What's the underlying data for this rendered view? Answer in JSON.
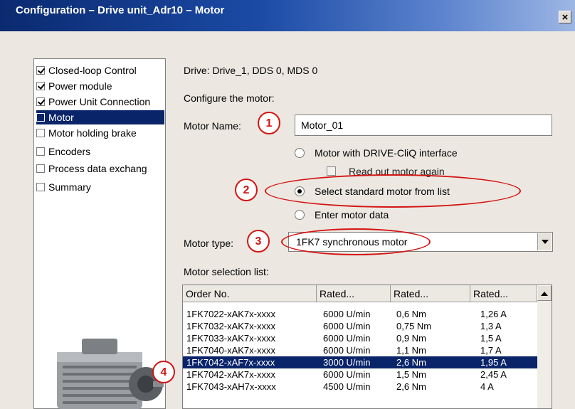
{
  "window": {
    "title": "Configuration – Drive unit_Adr10 – Motor",
    "close_label": "×"
  },
  "nav": {
    "items": [
      {
        "label": "Closed-loop Control",
        "checked": true,
        "selected": false
      },
      {
        "label": "Power module",
        "checked": true,
        "selected": false
      },
      {
        "label": "Power Unit Connection",
        "checked": true,
        "selected": false
      },
      {
        "label": "Motor",
        "checked": false,
        "selected": true
      },
      {
        "label": "Motor holding brake",
        "checked": false,
        "selected": false
      },
      {
        "label": "Encoders",
        "checked": false,
        "selected": false
      },
      {
        "label": "Process data exchang",
        "checked": false,
        "selected": false
      },
      {
        "label": "Summary",
        "checked": false,
        "selected": false
      }
    ]
  },
  "main": {
    "drive_info": "Drive: Drive_1, DDS 0, MDS 0",
    "configure_label": "Configure the motor:",
    "motor_name_label": "Motor Name:",
    "motor_name_value": "Motor_01",
    "options": {
      "drivecliq": "Motor with DRIVE-CliQ interface",
      "readout": "Read out motor again",
      "standard": "Select standard motor from list",
      "enter": "Enter motor data",
      "selected": "standard"
    },
    "motor_type_label": "Motor type:",
    "motor_type_value": "1FK7 synchronous motor",
    "selection_list_label": "Motor selection list:"
  },
  "table": {
    "columns": [
      "Order No.",
      "Rated...",
      "Rated...",
      "Rated..."
    ],
    "rows": [
      [
        "1FK7022-xAK7x-xxxx",
        "6000 U/min",
        "0,6 Nm",
        "1,26 A"
      ],
      [
        "1FK7032-xAK7x-xxxx",
        "6000 U/min",
        "0,75 Nm",
        "1,3 A"
      ],
      [
        "1FK7033-xAK7x-xxxx",
        "6000 U/min",
        "0,9 Nm",
        "1,5 A"
      ],
      [
        "1FK7040-xAK7x-xxxx",
        "6000 U/min",
        "1,1 Nm",
        "1,7 A"
      ],
      [
        "1FK7042-xAF7x-xxxx",
        "3000 U/min",
        "2,6 Nm",
        "1,95 A"
      ],
      [
        "1FK7042-xAK7x-xxxx",
        "6000 U/min",
        "1,5 Nm",
        "2,45 A"
      ],
      [
        "1FK7043-xAH7x-xxxx",
        "4500 U/min",
        "2,6 Nm",
        "4 A"
      ]
    ],
    "selected_row": 4
  },
  "annotations": [
    "1",
    "2",
    "3",
    "4"
  ],
  "colors": {
    "selection": "#0a246a",
    "annotation": "#d41414",
    "title_start": "#0b2a70"
  }
}
